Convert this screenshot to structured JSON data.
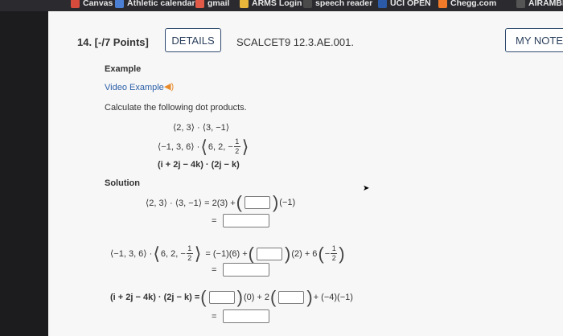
{
  "bookmarks": [
    {
      "label": "Canvas",
      "color": "#d64b3b"
    },
    {
      "label": "Athletic calendar",
      "color": "#4a7fd4"
    },
    {
      "label": "gmail",
      "color": "#e05a47"
    },
    {
      "label": "ARMS Login",
      "color": "#e8b63a"
    },
    {
      "label": "speech reader",
      "color": "#4a4a4a"
    },
    {
      "label": "UCI OPEN",
      "color": "#2a5aa8"
    },
    {
      "label": "Chegg.com",
      "color": "#f07a2a"
    },
    {
      "label": "AIRAMBE",
      "color": "#555555"
    }
  ],
  "question": {
    "number_label": "14. [-/7 Points]",
    "details_label": "DETAILS",
    "code": "SCALCET9 12.3.AE.001.",
    "my_notes_label": "MY NOTES"
  },
  "example": {
    "heading": "Example",
    "video_link": "Video Example",
    "speaker_icon": "speaker-icon",
    "instruction": "Calculate the following dot products.",
    "line1": "⟨2, 3⟩ · ⟨3, −1⟩",
    "line2_prefix": "⟨−1, 3, 6⟩ · ",
    "line2_inner": "6, 2, −",
    "half_num": "1",
    "half_den": "2",
    "line3": "(i + 2j − 4k) · (2j − k)"
  },
  "solution": {
    "heading": "Solution",
    "r1_left": "⟨2, 3⟩ · ⟨3, −1⟩ = 2(3) +",
    "r1_right": "(−1)",
    "eq": "=",
    "r3_left_a": "⟨−1, 3, 6⟩ · ",
    "r3_left_b": "6, 2, −",
    "r3_mid": "= (−1)(6) +",
    "r3_b": "(2) + 6",
    "r3_c": "−",
    "r5_left": "(i + 2j − 4k) · (2j − k) =",
    "r5_a": "(0) + 2",
    "r5_b": "+ (−4)(−1)"
  }
}
